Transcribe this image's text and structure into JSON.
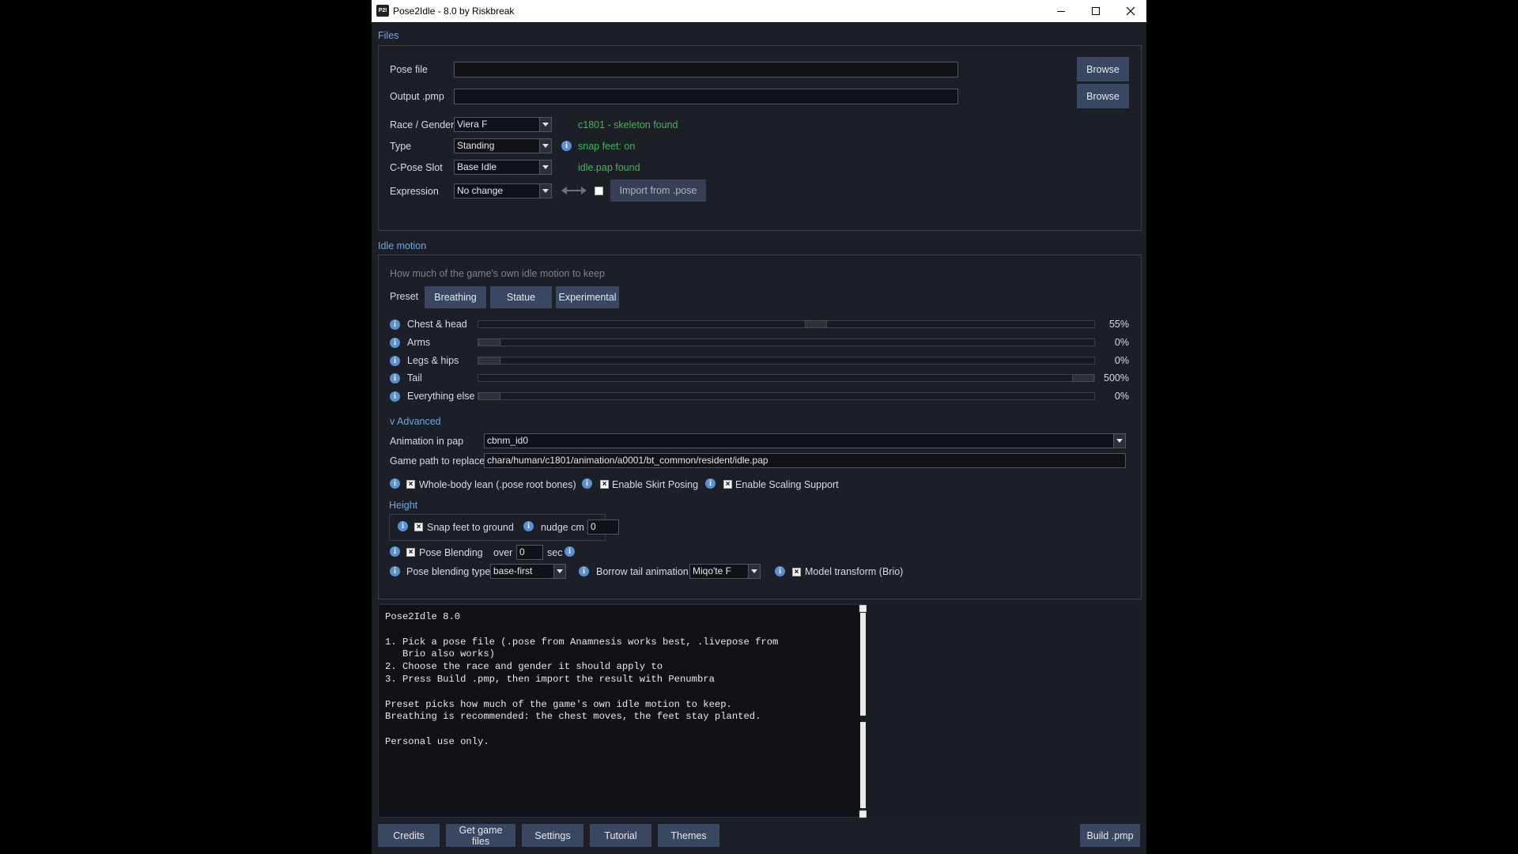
{
  "window": {
    "title": "Pose2Idle - 8.0 by Riskbreak",
    "icon_text": "P2I",
    "controls": [
      "minimize-icon",
      "maximize-icon",
      "close-icon"
    ]
  },
  "files": {
    "section_title": "Files",
    "pose_file": {
      "label": "Pose file",
      "value": "",
      "browse": "Browse"
    },
    "output_pmp": {
      "label": "Output .pmp",
      "value": "",
      "browse": "Browse"
    },
    "race_gender": {
      "label": "Race / Gender",
      "value": "Viera F",
      "status": "c1801 - skeleton found"
    },
    "type": {
      "label": "Type",
      "value": "Standing",
      "status": "snap feet: on"
    },
    "cpose_slot": {
      "label": "C-Pose Slot",
      "value": "Base Idle",
      "status": "idle.pap found"
    },
    "expression": {
      "label": "Expression",
      "value": "No change",
      "checked": false,
      "import_button": "Import from .pose"
    }
  },
  "idle_motion": {
    "section_title": "Idle motion",
    "hint": "How much of the game's own idle motion to keep",
    "preset_label": "Preset",
    "presets": [
      "Breathing",
      "Statue",
      "Experimental"
    ],
    "sliders": [
      {
        "label": "Chest & head",
        "value_text": "55%",
        "fraction": 0.55
      },
      {
        "label": "Arms",
        "value_text": "0%",
        "fraction": 0.0
      },
      {
        "label": "Legs & hips",
        "value_text": "0%",
        "fraction": 0.0
      },
      {
        "label": "Tail",
        "value_text": "500%",
        "fraction": 1.0
      },
      {
        "label": "Everything else",
        "value_text": "0%",
        "fraction": 0.0
      }
    ],
    "advanced_toggle": "v Advanced",
    "animation_in_pap": {
      "label": "Animation in pap",
      "value": "cbnm_id0"
    },
    "game_path": {
      "label": "Game path to replace",
      "value": "chara/human/c1801/animation/a0001/bt_common/resident/idle.pap"
    },
    "options": [
      {
        "label": "Whole-body lean (.pose root bones)",
        "checked": true
      },
      {
        "label": "Enable Skirt Posing",
        "checked": true
      },
      {
        "label": "Enable Scaling Support",
        "checked": true
      }
    ],
    "height": {
      "title": "Height",
      "snap_feet": {
        "label": "Snap feet to ground",
        "checked": true
      },
      "nudge": {
        "label": "nudge cm",
        "value": "0"
      }
    },
    "pose_blending": {
      "label": "Pose Blending",
      "checked": true,
      "over_label": "over",
      "value": "0",
      "unit": "sec"
    },
    "blend_type": {
      "label": "Pose blending type",
      "value": "base-first"
    },
    "borrow_tail": {
      "label": "Borrow tail animation",
      "value": "Miqo'te F"
    },
    "model_transform": {
      "label": "Model transform (Brio)",
      "checked": true
    }
  },
  "log": {
    "text": "Pose2Idle 8.0\n\n1. Pick a pose file (.pose from Anamnesis works best, .livepose from\n   Brio also works)\n2. Choose the race and gender it should apply to\n3. Press Build .pmp, then import the result with Penumbra\n\nPreset picks how much of the game's own idle motion to keep.\nBreathing is recommended: the chest moves, the feet stay planted.\n\nPersonal use only."
  },
  "footer": {
    "buttons": [
      "Credits",
      "Get game files",
      "Settings",
      "Tutorial",
      "Themes"
    ],
    "build": "Build .pmp"
  },
  "colors": {
    "window_bg": "#1c1f26",
    "accent": "#6fa6e6",
    "button": "#3a4763",
    "ok_green": "#3cba54",
    "info_blue": "#5b8fd6"
  }
}
